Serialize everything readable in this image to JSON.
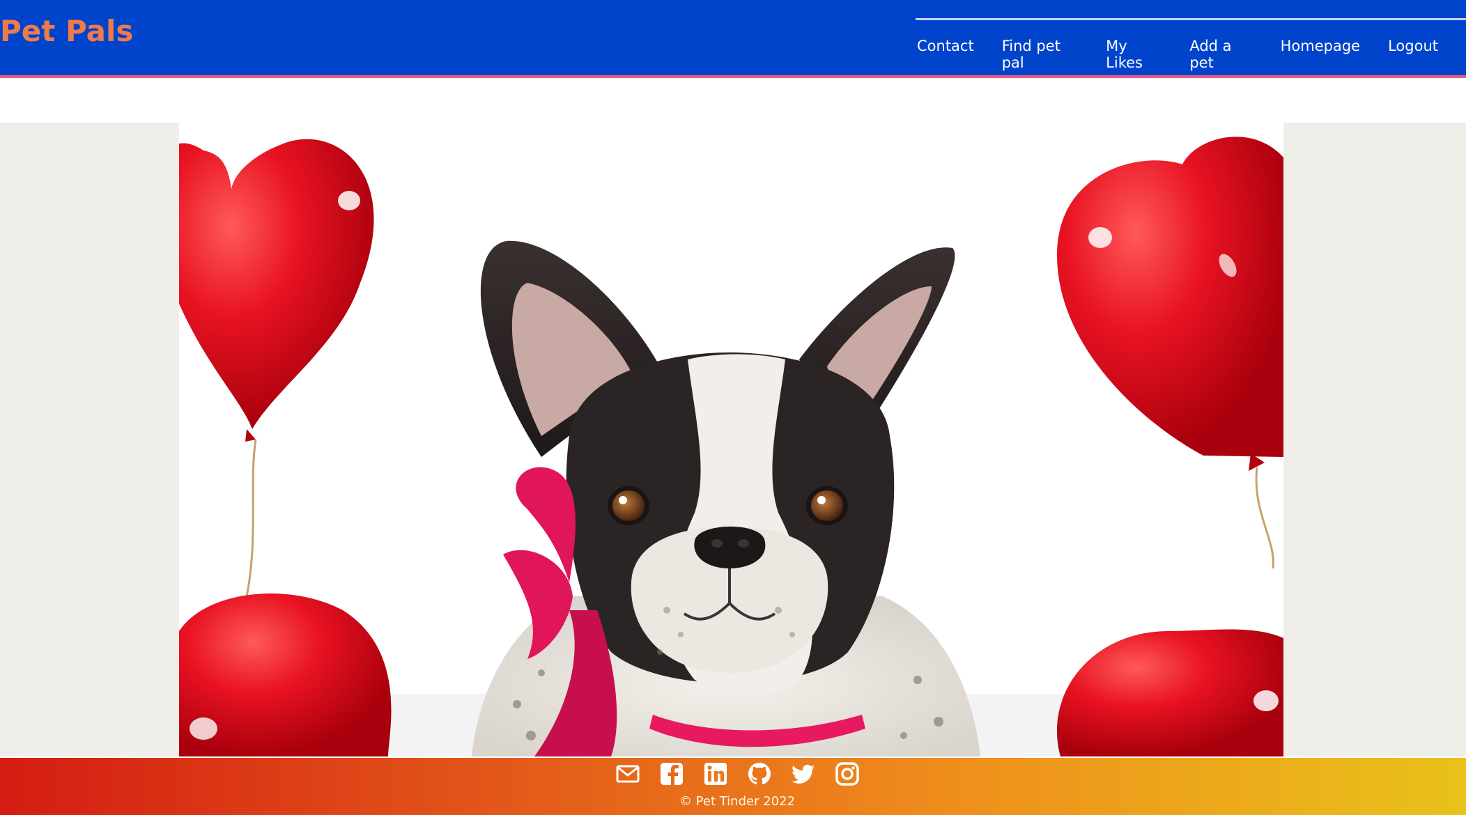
{
  "header": {
    "brand": "Pet Pals",
    "brand_color": "#f07a4a",
    "background": "#0044cc",
    "nav": [
      {
        "label": "Contact"
      },
      {
        "label": "Find pet pal"
      },
      {
        "label": "My Likes"
      },
      {
        "label": "Add a pet"
      },
      {
        "label": "Homepage"
      },
      {
        "label": "Logout"
      }
    ]
  },
  "hero": {
    "image_semantic": "french-bulldog-with-heart-balloons"
  },
  "footer": {
    "icons": [
      "mail-icon",
      "facebook-icon",
      "linkedin-icon",
      "github-icon",
      "twitter-icon",
      "instagram-icon"
    ],
    "copyright": "© Pet Tinder 2022",
    "gradient": [
      "#d41c12",
      "#e9c21a"
    ]
  }
}
